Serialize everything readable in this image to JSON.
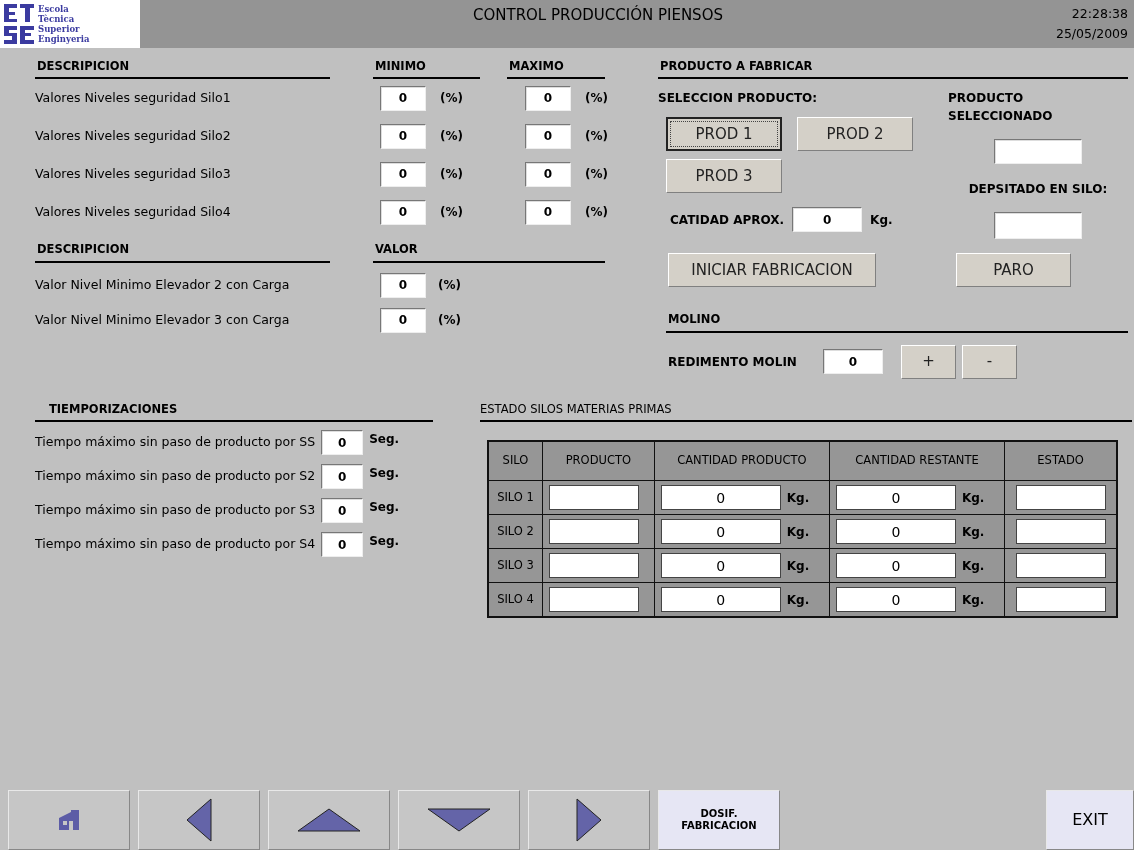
{
  "header": {
    "logo_lines": [
      "Escola",
      "Tècnica",
      "Superior",
      "Enginyeria"
    ],
    "title": "CONTROL PRODUCCIÓN PIENSOS",
    "time": "22:28:38",
    "date": "25/05/2009"
  },
  "levels": {
    "headers": [
      "DESCRIPICION",
      "MINIMO",
      "MAXIMO"
    ],
    "rows": [
      {
        "label": "Valores Niveles seguridad Silo1",
        "min": "0",
        "min_unit": "(%)",
        "max": "0",
        "max_unit": "(%)"
      },
      {
        "label": "Valores Niveles seguridad Silo2",
        "min": "0",
        "min_unit": "(%)",
        "max": "0",
        "max_unit": "(%)"
      },
      {
        "label": "Valores Niveles seguridad Silo3",
        "min": "0",
        "min_unit": "(%)",
        "max": "0",
        "max_unit": "(%)"
      },
      {
        "label": "Valores Niveles seguridad Silo4",
        "min": "0",
        "min_unit": "(%)",
        "max": "0",
        "max_unit": "(%)"
      }
    ]
  },
  "elevators": {
    "headers": [
      "DESCRIPICION",
      "VALOR"
    ],
    "rows": [
      {
        "label": "Valor Nivel Minimo Elevador 2 con Carga",
        "value": "0",
        "unit": "(%)"
      },
      {
        "label": "Valor Nivel Minimo Elevador 3 con Carga",
        "value": "0",
        "unit": "(%)"
      }
    ]
  },
  "product": {
    "title": "PRODUCTO A FABRICAR",
    "select_label": "SELECCION PRODUCTO:",
    "buttons": [
      {
        "label": "PROD 1",
        "selected": true
      },
      {
        "label": "PROD 2",
        "selected": false
      },
      {
        "label": "PROD 3",
        "selected": false
      }
    ],
    "selected_label": "PRODUCTO SELECCIONADO",
    "deposited_label": "DEPSITADO EN SILO:",
    "quantity_label": "CATIDAD APROX.",
    "quantity_value": "0",
    "quantity_unit": "Kg.",
    "start_button": "INICIAR FABRICACION",
    "stop_button": "PARO"
  },
  "mill": {
    "title": "MOLINO",
    "label": "REDIMENTO MOLIN",
    "value": "0",
    "buttons": [
      "+",
      "-"
    ]
  },
  "timers": {
    "title": "TIEMPORIZACIONES",
    "rows": [
      {
        "label": "Tiempo máximo sin paso de producto por SS",
        "value": "0",
        "unit": "Seg."
      },
      {
        "label": "Tiempo máximo sin paso de producto por S2",
        "value": "0",
        "unit": "Seg."
      },
      {
        "label": "Tiempo máximo sin paso de producto por S3",
        "value": "0",
        "unit": "Seg."
      },
      {
        "label": "Tiempo máximo sin paso de producto por S4",
        "value": "0",
        "unit": "Seg."
      }
    ]
  },
  "silos": {
    "title": "ESTADO SILOS MATERIAS PRIMAS",
    "columns": [
      "SILO",
      "PRODUCTO",
      "CANTIDAD PRODUCTO",
      "CANTIDAD RESTANTE",
      "ESTADO"
    ],
    "rows": [
      {
        "silo": "SILO 1",
        "quantity": "0",
        "quantity_unit": "Kg.",
        "remaining": "0",
        "remaining_unit": "Kg."
      },
      {
        "silo": "SILO 2",
        "quantity": "0",
        "quantity_unit": "Kg.",
        "remaining": "0",
        "remaining_unit": "Kg."
      },
      {
        "silo": "SILO 3",
        "quantity": "0",
        "quantity_unit": "Kg.",
        "remaining": "0",
        "remaining_unit": "Kg."
      },
      {
        "silo": "SILO 4",
        "quantity": "0",
        "quantity_unit": "Kg.",
        "remaining": "0",
        "remaining_unit": "Kg."
      }
    ]
  },
  "footer": {
    "buttons": [
      {
        "kind": "home"
      },
      {
        "kind": "left"
      },
      {
        "kind": "up"
      },
      {
        "kind": "down"
      },
      {
        "kind": "right"
      },
      {
        "kind": "text",
        "lines": [
          "DOSIF.",
          "FABRICACION"
        ]
      }
    ],
    "exit": "EXIT"
  }
}
